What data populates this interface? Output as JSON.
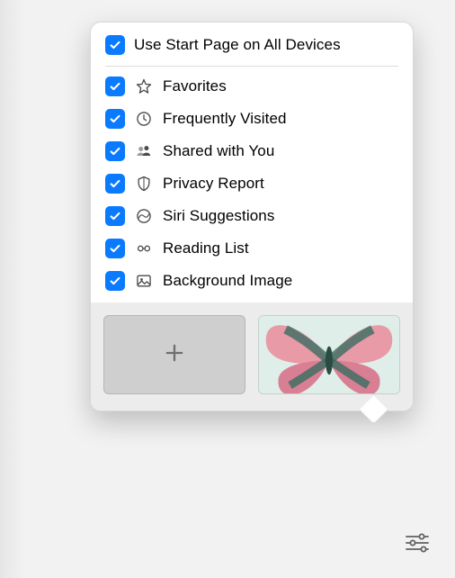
{
  "popover": {
    "header": {
      "label": "Use Start Page on All Devices",
      "checked": true
    },
    "items": [
      {
        "icon": "star-icon",
        "label": "Favorites",
        "checked": true
      },
      {
        "icon": "clock-icon",
        "label": "Frequently Visited",
        "checked": true
      },
      {
        "icon": "people-icon",
        "label": "Shared with You",
        "checked": true
      },
      {
        "icon": "shield-icon",
        "label": "Privacy Report",
        "checked": true
      },
      {
        "icon": "siri-icon",
        "label": "Siri Suggestions",
        "checked": true
      },
      {
        "icon": "glasses-icon",
        "label": "Reading List",
        "checked": true
      },
      {
        "icon": "image-icon",
        "label": "Background Image",
        "checked": true
      }
    ],
    "thumbnails": {
      "add_label": "Add custom background",
      "preset_label": "Butterfly wallpaper"
    }
  },
  "toolbar": {
    "settings_label": "Customize Start Page"
  },
  "colors": {
    "accent": "#0a7aff",
    "panel_bg": "#ffffff",
    "strip_bg": "#ececec",
    "page_bg": "#f2f2f2"
  }
}
